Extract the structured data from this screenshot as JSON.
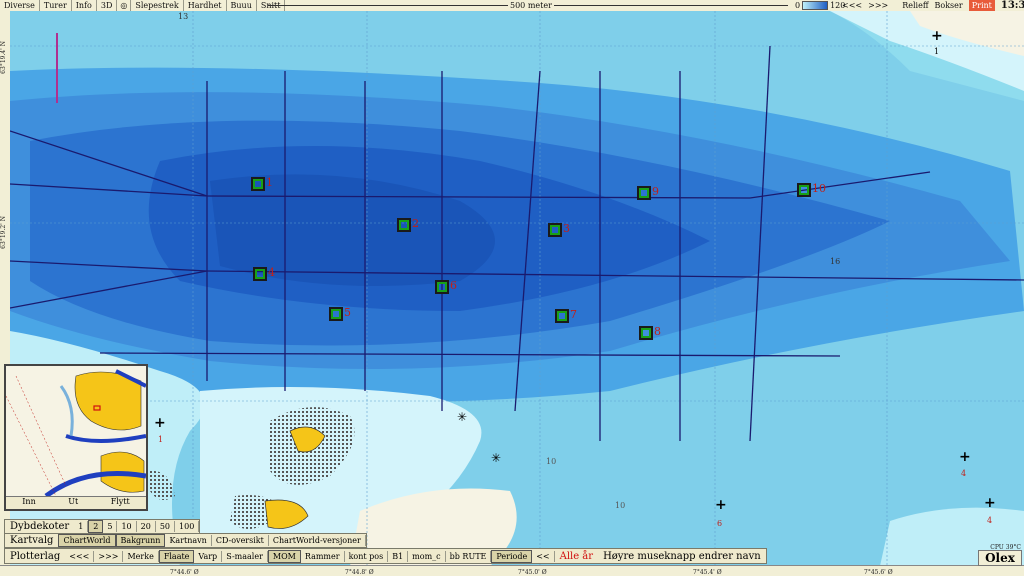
{
  "topbar": {
    "menu": [
      "Diverse",
      "Turer",
      "Info",
      "3D",
      "Slepestrek",
      "Hardhet",
      "Buuu",
      "Snitt"
    ],
    "scale_label": "500 meter",
    "depth_min": "0",
    "depth_max": "120",
    "nav_prev": "<<<",
    "nav_next": ">>>",
    "relieff": "Relieff",
    "bokser": "Bokser",
    "print": "Print",
    "time": "13:37:31"
  },
  "map": {
    "markers": [
      {
        "label": "1"
      },
      {
        "label": "2"
      },
      {
        "label": "3"
      },
      {
        "label": "4"
      },
      {
        "label": "5"
      },
      {
        "label": "6"
      },
      {
        "label": "7"
      },
      {
        "label": "8"
      },
      {
        "label": "9"
      },
      {
        "label": "10"
      }
    ],
    "depth_labels": [
      "13",
      "16",
      "10",
      "10",
      "1",
      "1",
      "4",
      "4",
      "6"
    ],
    "lat_labels": [
      "63°19.4' N",
      "63°19.2' N"
    ],
    "lon_labels": [
      "7°44.6' Ø",
      "7°44.8' Ø",
      "7°45.0' Ø",
      "7°45.2' Ø",
      "7°45.4' Ø",
      "7°45.6' Ø"
    ]
  },
  "dybdekoter": {
    "label": "Dybdekoter",
    "values": [
      "1",
      "2",
      "5",
      "10",
      "20",
      "50",
      "100"
    ],
    "selected": "2"
  },
  "minimap_buttons": [
    "Inn",
    "Ut",
    "Flytt"
  ],
  "kartvalg": {
    "label": "Kartvalg",
    "buttons": [
      "ChartWorld",
      "Bakgrunn",
      "Kartnavn",
      "CD-oversikt",
      "ChartWorld-versjoner"
    ]
  },
  "plotterlag": {
    "label": "Plotterlag",
    "buttons": [
      "<<<",
      ">>>",
      "Merke",
      "Flaate",
      "Varp",
      "S-maaler",
      "MOM",
      "Rammer",
      "kont pos",
      "B1",
      "mom_c",
      "bb RUTE",
      "Periode",
      "<<"
    ],
    "alle_ar": "Alle år",
    "hint": "Høyre museknapp endrer navn"
  },
  "brand": "Olex",
  "cpu": "CPU 39°C",
  "colors": {
    "deep": "#1f5fc4",
    "mid": "#3f97e0",
    "shallow": "#7fd6ec",
    "land": "#f6f3e4",
    "yellow": "#f5c518",
    "track": "#1a1a6e",
    "marker": "#18a018"
  }
}
